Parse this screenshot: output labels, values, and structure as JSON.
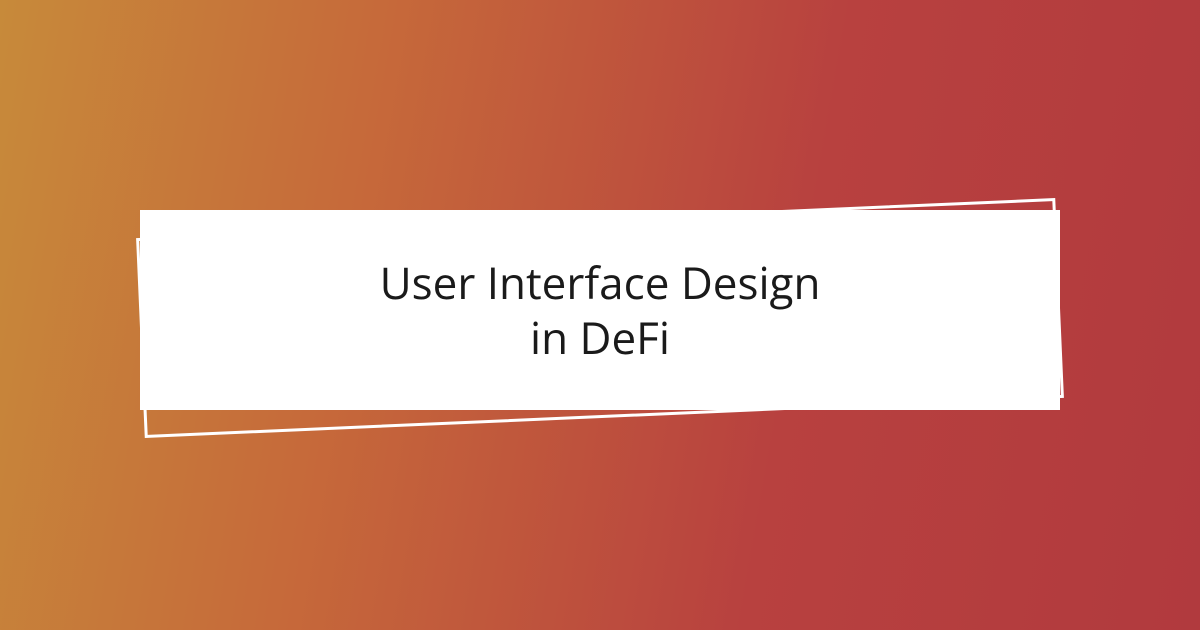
{
  "card": {
    "title": "User Interface Design\nin DeFi"
  }
}
